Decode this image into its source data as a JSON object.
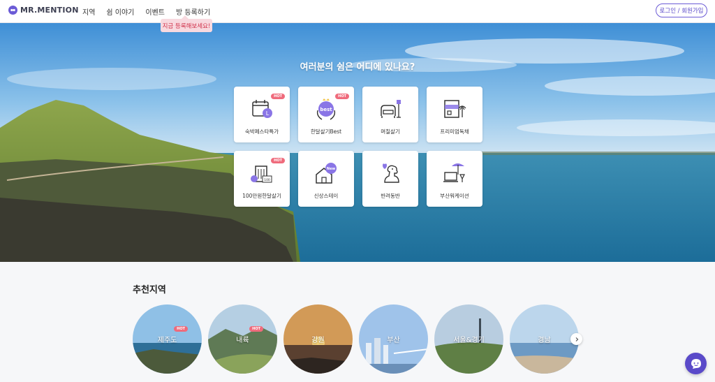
{
  "header": {
    "logo_text": "MR.MENTION",
    "nav": [
      "지역",
      "쉼 이야기",
      "이벤트",
      "방 등록하기"
    ],
    "login_label": "로그인 / 회원가입",
    "tooltip": "지금 등록해보세요!"
  },
  "hero": {
    "title": "여러분의 쉼은 어디에 있나요?",
    "categories": [
      {
        "label": "숙박페스타특가",
        "icon": "calendar-icon",
        "hot": "HOT"
      },
      {
        "label": "한달살기Best",
        "icon": "best-badge-icon",
        "hot": "HOT"
      },
      {
        "label": "며칠살기",
        "icon": "armchair-lamp-icon",
        "hot": ""
      },
      {
        "label": "프리미엄독채",
        "icon": "house-palm-icon",
        "hot": ""
      },
      {
        "label": "100만원한달살기",
        "icon": "building-price-icon",
        "hot": "HOT"
      },
      {
        "label": "신상스테이",
        "icon": "new-house-icon",
        "hot": ""
      },
      {
        "label": "반려동반",
        "icon": "dog-heart-icon",
        "hot": ""
      },
      {
        "label": "부산워케이션",
        "icon": "laptop-parasol-icon",
        "hot": ""
      }
    ]
  },
  "recommend": {
    "title": "추천지역",
    "regions": [
      {
        "name": "제주도",
        "hot": "HOT"
      },
      {
        "name": "내륙",
        "hot": "HOT"
      },
      {
        "name": "강원",
        "hot": ""
      },
      {
        "name": "부산",
        "hot": ""
      },
      {
        "name": "서울&경기",
        "hot": ""
      },
      {
        "name": "경남",
        "hot": ""
      }
    ]
  },
  "colors": {
    "accent": "#6b5bd6",
    "hot": "#ef6b7c"
  }
}
